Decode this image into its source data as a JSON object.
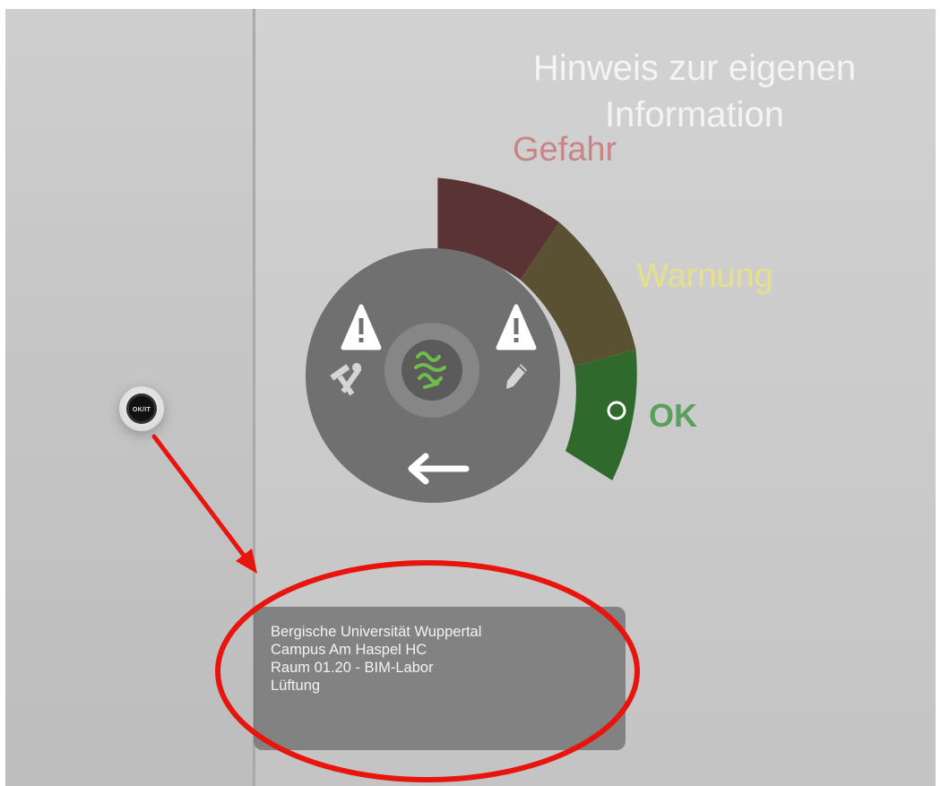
{
  "title": {
    "line1": "Hinweis zur eigenen",
    "line2": "Information"
  },
  "levels": {
    "danger": "Gefahr",
    "warning": "Warnung",
    "ok": "OK"
  },
  "level_colors": {
    "danger": "#5a3434",
    "warning": "#5a5133",
    "ok": "#2f6a2c"
  },
  "current_level": "ok",
  "menu": {
    "warning_left_icon": "warning-triangle-icon",
    "warning_right_icon": "warning-triangle-icon",
    "tools_icon": "hammer-wrench-icon",
    "edit_icon": "pencil-icon",
    "center_icon": "green-logo-icon",
    "back_icon": "arrow-left-icon"
  },
  "device": {
    "button_label": "OK/IT"
  },
  "info_panel": {
    "line1": "Bergische Universität Wuppertal",
    "line2": "Campus Am Haspel HC",
    "line3": "Raum 01.20 - BIM-Labor",
    "line4": "Lüftung"
  },
  "annotation": {
    "color": "#e8150f"
  }
}
